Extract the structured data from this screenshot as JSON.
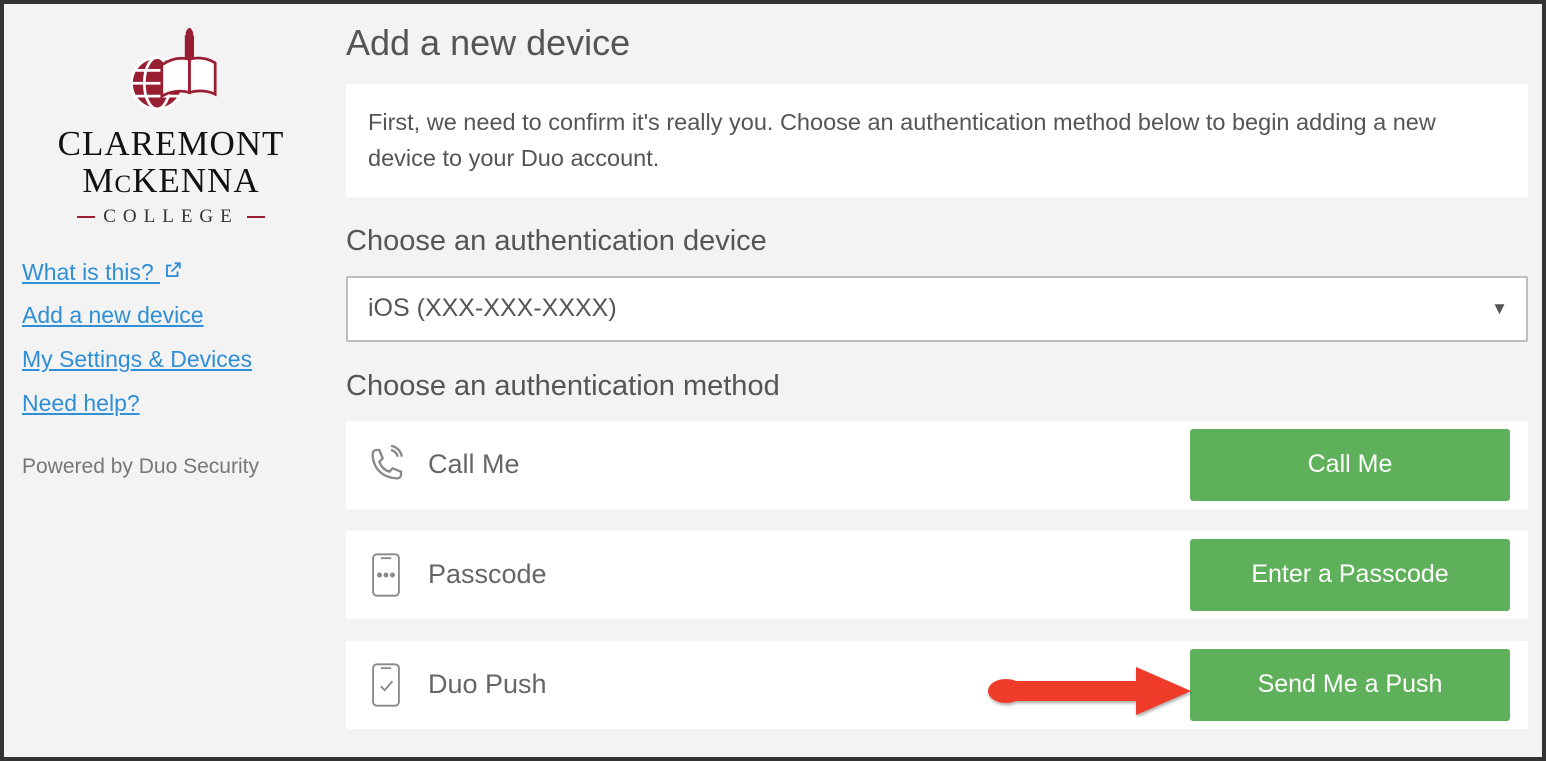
{
  "logo": {
    "line1": "CLAREMONT",
    "line2_mc": "M",
    "line2_c_small": "C",
    "line2_rest": "KENNA",
    "college": "COLLEGE"
  },
  "sidebar": {
    "links": {
      "what": "What is this?",
      "add": "Add a new device",
      "settings": "My Settings & Devices",
      "help": "Need help?"
    },
    "powered_by": "Powered by Duo Security"
  },
  "main": {
    "title": "Add a new device",
    "info": "First, we need to confirm it's really you. Choose an authentication method below to begin adding a new device to your Duo account.",
    "device_heading": "Choose an authentication device",
    "device_selected": "iOS (XXX-XXX-XXXX)",
    "method_heading": "Choose an authentication method",
    "methods": [
      {
        "label": "Call Me",
        "button": "Call Me"
      },
      {
        "label": "Passcode",
        "button": "Enter a Passcode"
      },
      {
        "label": "Duo Push",
        "button": "Send Me a Push"
      }
    ]
  }
}
